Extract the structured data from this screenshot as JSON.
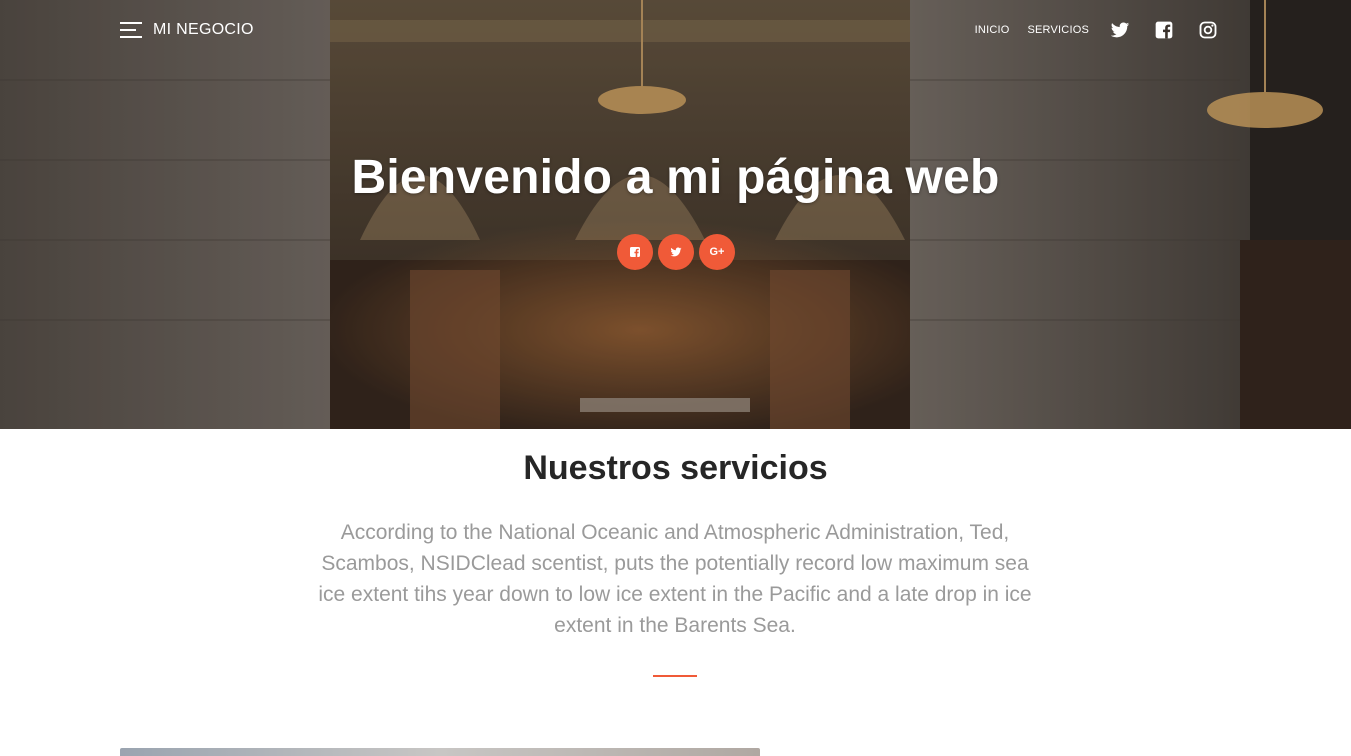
{
  "navbar": {
    "brand": "MI NEGOCIO",
    "links": [
      {
        "label": "INICIO"
      },
      {
        "label": "SERVICIOS"
      }
    ],
    "icons": [
      "twitter-icon",
      "facebook-icon",
      "instagram-icon"
    ]
  },
  "hero": {
    "title": "Bienvenido a mi página web",
    "social": [
      "facebook-icon",
      "twitter-icon",
      "google-plus-icon"
    ],
    "google_plus_label": "G+"
  },
  "services": {
    "title": "Nuestros servicios",
    "text": "According to the National Oceanic and Atmospheric Administration, Ted, Scambos, NSIDClead scentist, puts the potentially record low maximum sea ice extent tihs year down to low ice extent in the Pacific and a late drop in ice extent in the Barents Sea."
  },
  "colors": {
    "accent": "#f05a38",
    "heading": "#262626",
    "body_text": "#9a9a9a",
    "white": "#ffffff"
  }
}
